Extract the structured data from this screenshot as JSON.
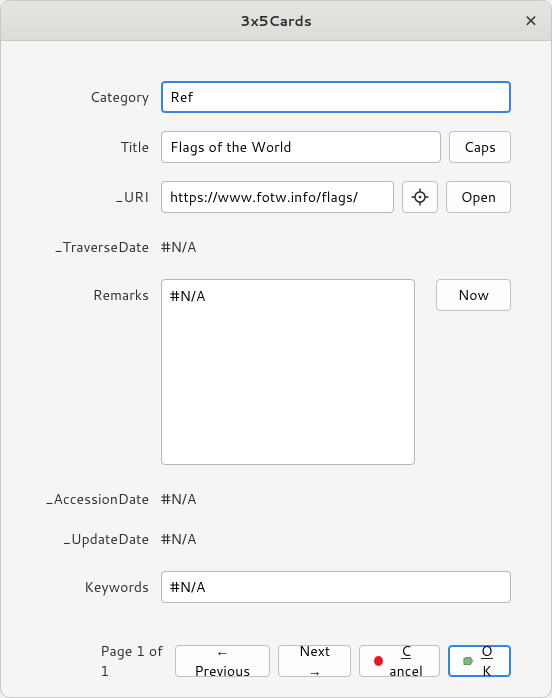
{
  "window": {
    "title": "3x5Cards"
  },
  "labels": {
    "category": "Category",
    "title": "Title",
    "uri": "_URI",
    "traverseDate": "_TraverseDate",
    "remarks": "Remarks",
    "accessionDate": "_AccessionDate",
    "updateDate": "_UpdateDate",
    "keywords": "Keywords"
  },
  "fields": {
    "category": "Ref",
    "title": "Flags of the World",
    "uri": "https://www.fotw.info/flags/",
    "traverseDate": "#N/A",
    "remarks": "#N/A",
    "accessionDate": "#N/A",
    "updateDate": "#N/A",
    "keywords": "#N/A"
  },
  "buttons": {
    "caps": "Caps",
    "open": "Open",
    "now": "Now",
    "previous": "← Previous",
    "next": "Next →",
    "cancel_u": "C",
    "cancel_rest": "ancel",
    "ok_u": "O",
    "ok_rest": "K"
  },
  "footer": {
    "page": "Page 1 of 1"
  }
}
